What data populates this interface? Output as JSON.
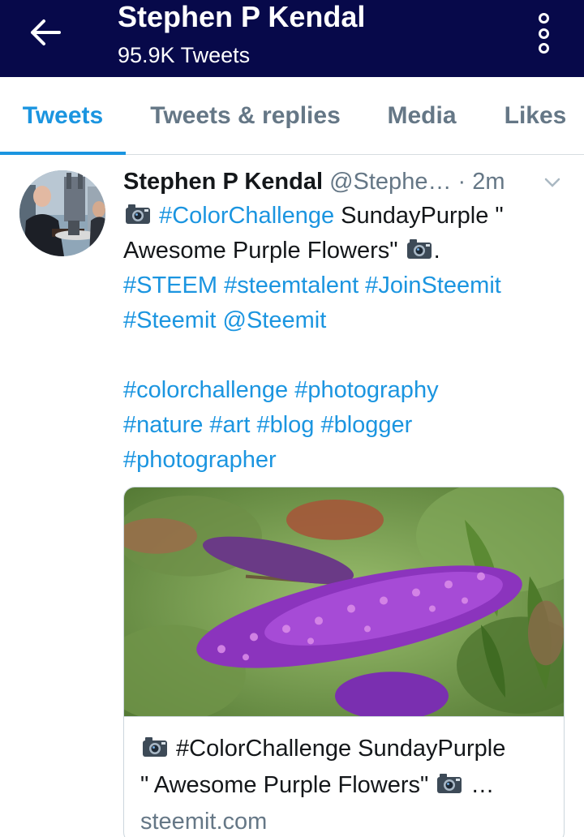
{
  "header": {
    "title": "Stephen P Kendal",
    "subtitle": "95.9K Tweets",
    "background": "#07094a"
  },
  "tabs": [
    {
      "label": "Tweets",
      "active": true
    },
    {
      "label": "Tweets & replies",
      "active": false
    },
    {
      "label": "Media",
      "active": false
    },
    {
      "label": "Likes",
      "active": false
    }
  ],
  "accent_color": "#1b95e0",
  "tweet": {
    "name": "Stephen P Kendal",
    "handle": "@Stephe…",
    "separator": "·",
    "time": "2m",
    "text": {
      "hashtag_colorchallenge": "#ColorChallenge",
      "line1_rest": " SundayPurple \"",
      "line2": "Awesome Purple Flowers\" ",
      "line2_end": ".",
      "line3": "#STEEM #steemtalent #JoinSteemit",
      "line4": "#Steemit @Steemit",
      "line5": "#colorchallenge #photography",
      "line6": "#nature #art #blog #blogger",
      "line7": "#photographer"
    },
    "card": {
      "title_line1": " #ColorChallenge SundayPurple",
      "title_line2_start": "\" Awesome Purple Flowers\" ",
      "title_line2_end": " …",
      "domain": "steemit.com"
    }
  },
  "icons": {
    "back": "arrow-left-icon",
    "more": "vertical-dots-icon",
    "caret": "chevron-down-icon",
    "camera": "camera-emoji-icon"
  }
}
